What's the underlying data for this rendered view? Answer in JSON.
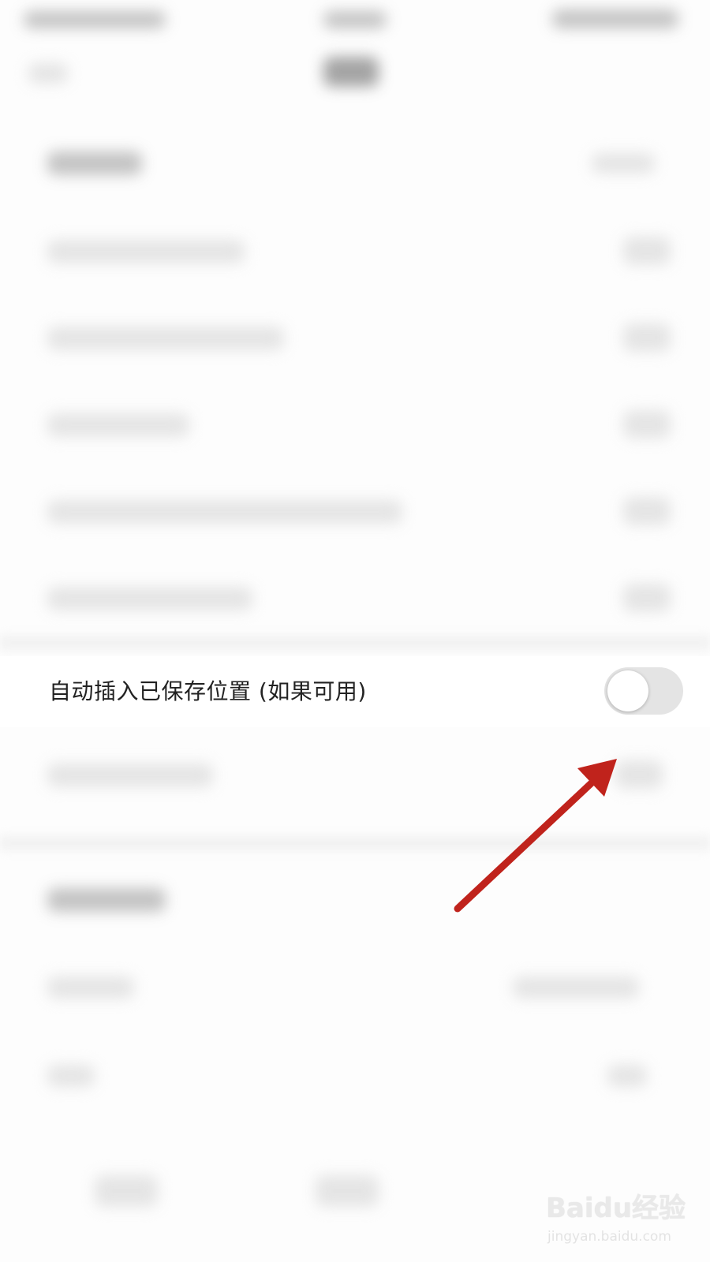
{
  "settings": {
    "focused_row": {
      "label": "自动插入已保存位置 (如果可用)",
      "toggle_on": false
    }
  },
  "annotation": {
    "arrow_color": "#c0231c"
  },
  "watermark": {
    "brand": "Baidu经验",
    "url": "jingyan.baidu.com"
  },
  "colors": {
    "toggle_track_off": "#e4e4e4",
    "toggle_knob": "#ffffff",
    "label_text": "#222222"
  }
}
